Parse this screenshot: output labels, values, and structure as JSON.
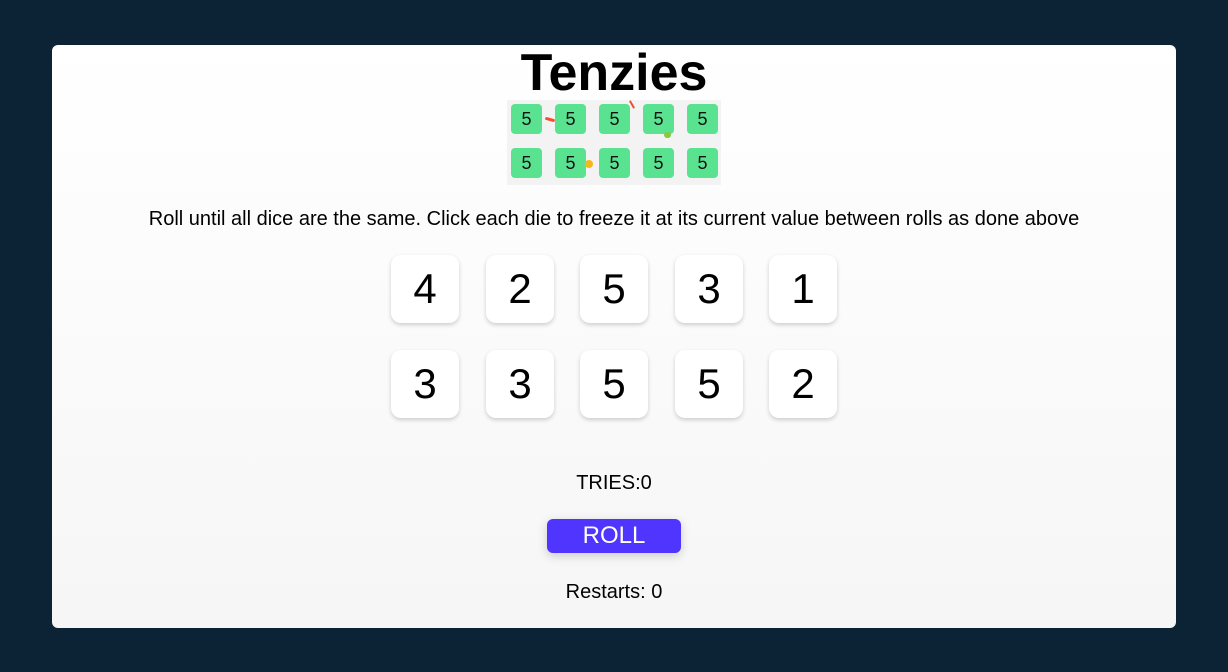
{
  "title": "Tenzies",
  "demo": {
    "dice": [
      "5",
      "5",
      "5",
      "5",
      "5",
      "5",
      "5",
      "5",
      "5",
      "5"
    ]
  },
  "instructions": "Roll until all dice are the same. Click each die to freeze it at its current value between rolls as done above",
  "dice": [
    "4",
    "2",
    "5",
    "3",
    "1",
    "3",
    "3",
    "5",
    "5",
    "2"
  ],
  "tries": "TRIES:0",
  "roll_label": "ROLL",
  "restarts": "Restarts: 0",
  "colors": {
    "background": "#0b2334",
    "held_die": "#59e391",
    "button": "#5035ff"
  }
}
